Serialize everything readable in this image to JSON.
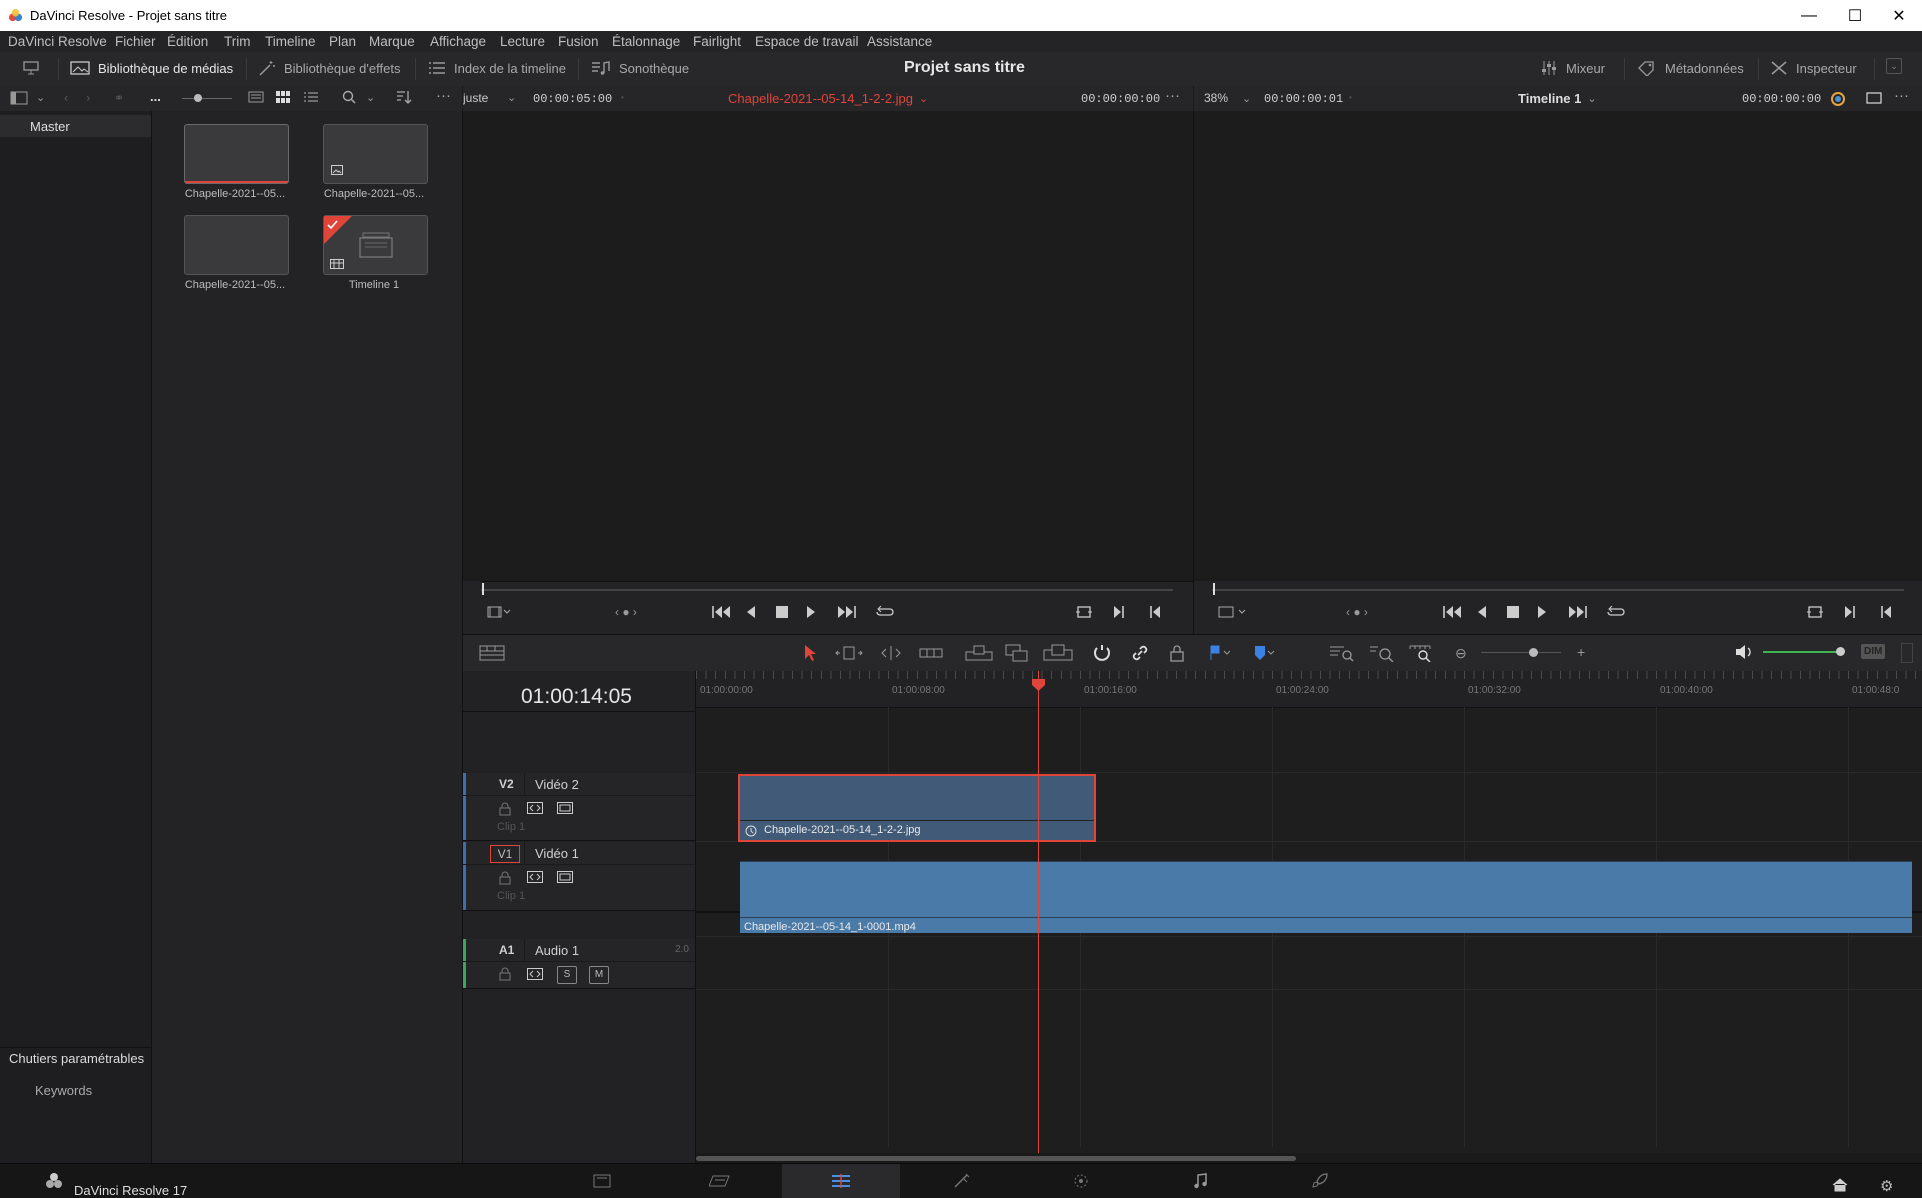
{
  "window": {
    "title": "DaVinci Resolve - Projet sans titre",
    "minimize": "—",
    "maximize": "☐",
    "close": "✕"
  },
  "menu": [
    "DaVinci Resolve",
    "Fichier",
    "Édition",
    "Trim",
    "Timeline",
    "Plan",
    "Marque",
    "Affichage",
    "Lecture",
    "Fusion",
    "Étalonnage",
    "Fairlight",
    "Espace de travail",
    "Assistance"
  ],
  "toolbar": {
    "media_library": "Bibliothèque de médias",
    "effects_library": "Bibliothèque d'effets",
    "timeline_index": "Index de la timeline",
    "sound_library": "Sonothèque",
    "project_title": "Projet sans titre",
    "mixer": "Mixeur",
    "metadata": "Métadonnées",
    "inspector": "Inspecteur"
  },
  "pool_bar": {
    "dots": "..."
  },
  "source_bar": {
    "fit": "Ajuste",
    "duration": "00:00:05:00",
    "clip_name": "Chapelle-2021--05-14_1-2-2.jpg",
    "timecode": "00:00:00:00"
  },
  "timeline_bar": {
    "zoom": "38%",
    "duration": "00:00:00:01",
    "timeline_name": "Timeline 1",
    "timecode": "00:00:00:00"
  },
  "bins": {
    "master": "Master",
    "smart_bins": "Chutiers paramétrables",
    "keywords": "Keywords"
  },
  "media": [
    {
      "label": "Chapelle-2021--05..."
    },
    {
      "label": "Chapelle-2021--05..."
    },
    {
      "label": "Chapelle-2021--05..."
    },
    {
      "label": "Timeline 1"
    }
  ],
  "timeline": {
    "current_tc": "01:00:14:05",
    "ruler": [
      "01:00:00:00",
      "01:00:08:00",
      "01:00:16:00",
      "01:00:24:00",
      "01:00:32:00",
      "01:00:40:00",
      "01:00:48:0"
    ],
    "tracks": {
      "v2": {
        "id": "V2",
        "name": "Vidéo 2",
        "clipcount": "Clip 1"
      },
      "v1": {
        "id": "V1",
        "name": "Vidéo 1",
        "clipcount": "Clip 1"
      },
      "a1": {
        "id": "A1",
        "name": "Audio 1",
        "channels": "2.0",
        "solo": "S",
        "mute": "M"
      }
    },
    "clips": {
      "v2": "Chapelle-2021--05-14_1-2-2.jpg",
      "v1": "Chapelle-2021--05-14_1-0001.mp4"
    }
  },
  "edit_tools": {
    "dim": "DIM"
  },
  "footer": {
    "app": "DaVinci Resolve 17"
  },
  "colors": {
    "accent_red": "#e0453a",
    "clip_blue": "#4a6f99",
    "playhead": "#e0453a"
  }
}
